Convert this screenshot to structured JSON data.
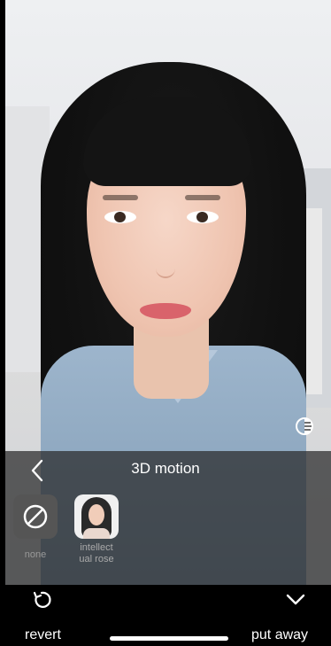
{
  "panel": {
    "title": "3D motion"
  },
  "options": [
    {
      "label": "none",
      "icon": "none-icon"
    },
    {
      "label": "intellect ual rose",
      "icon": "portrait-thumbnail"
    }
  ],
  "bottom_bar": {
    "revert_label": "revert",
    "put_away_label": "put away"
  },
  "icons": {
    "back": "chevron-left-icon",
    "contrast": "contrast-icon",
    "revert": "revert-icon",
    "put_away": "chevron-down-icon"
  }
}
